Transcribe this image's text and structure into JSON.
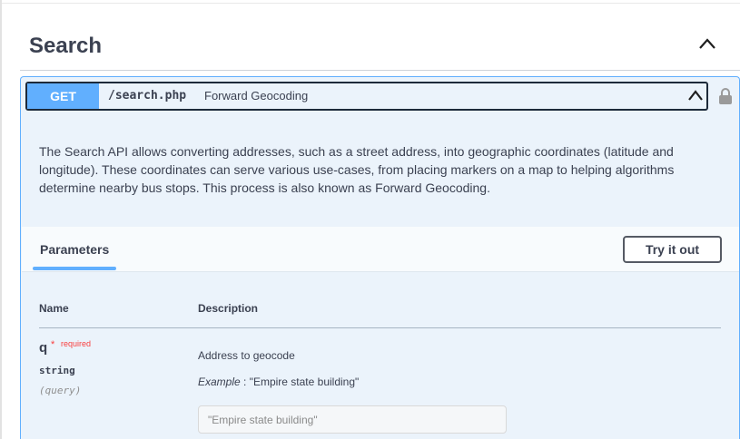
{
  "tag": {
    "title": "Search"
  },
  "operation": {
    "method": "GET",
    "path": "/search.php",
    "summary": "Forward Geocoding",
    "description": "The Search API allows converting addresses, such as a street address, into geographic coordinates (latitude and longitude). These coordinates can serve various use-cases, from placing markers on a map to helping algorithms determine nearby bus stops. This process is also known as Forward Geocoding."
  },
  "parameters": {
    "tab_label": "Parameters",
    "try_button": "Try it out",
    "columns": {
      "name": "Name",
      "description": "Description"
    },
    "items": [
      {
        "name": "q",
        "required_star": "*",
        "required_label": "required",
        "type": "string",
        "in": "(query)",
        "description": "Address to geocode",
        "example_label": "Example",
        "example_value": " : \"Empire state building\"",
        "placeholder": "\"Empire state building\""
      }
    ]
  },
  "colors": {
    "get_method": "#61affe",
    "opblock_bg": "#ebf3fb",
    "required": "#f93e3e",
    "text": "#3b4151"
  },
  "icons": {
    "tag_toggle": "chevron-up-icon",
    "op_toggle": "chevron-up-icon",
    "auth": "lock-icon"
  }
}
